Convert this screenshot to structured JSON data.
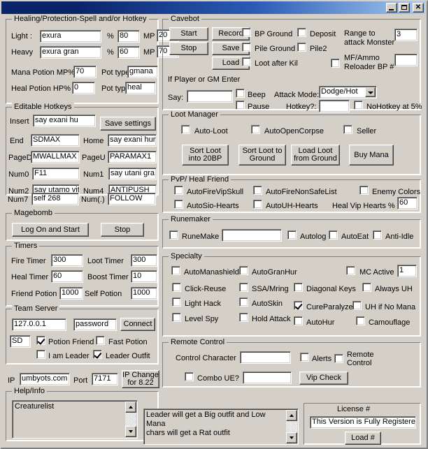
{
  "window": {
    "title": "",
    "minimize_label": "–",
    "maximize_label": "□",
    "close_label": "✕"
  },
  "healing": {
    "group_title": "Healing/Protection-Spell and/or Hotkey",
    "light_label": "Light :",
    "light_spell": "exura",
    "light_pct_sym": "%",
    "light_pct": "80",
    "light_mp_label": "MP",
    "light_mp": "20",
    "heavy_label": "Heavy",
    "heavy_spell": "exura gran",
    "heavy_pct_sym": "%",
    "heavy_pct": "60",
    "heavy_mp_label": "MP",
    "heavy_mp": "70",
    "mana_pot_label": "Mana Potion MP%",
    "mana_pot_value": "70",
    "mana_pot_type_label": "Pot type",
    "mana_pot_type": "gmana",
    "heal_pot_label": "Heal Potion HP%",
    "heal_pot_value": "0",
    "heal_pot_type_label": "Pot type",
    "heal_pot_type": "heal"
  },
  "hotkeys": {
    "group_title": "Editable Hotkeys",
    "save_button": "Save settings",
    "rows": [
      {
        "label": "Insert",
        "value": "say exani hu"
      },
      {
        "label": "End",
        "value": "SDMAX"
      },
      {
        "label": "Home",
        "value": "say exani hur"
      },
      {
        "label": "PageD",
        "value": "MWALLMAX"
      },
      {
        "label": "PageU",
        "value": "PARAMAX1"
      },
      {
        "label": "Num0",
        "value": "F11"
      },
      {
        "label": "Num1",
        "value": "say utani gra"
      },
      {
        "label": "Num2",
        "value": "say utamo vit"
      },
      {
        "label": "Num4",
        "value": "ANTIPUSH"
      },
      {
        "label": "Num7",
        "value": "self 268"
      },
      {
        "label": "Num(.)",
        "value": "FOLLOW"
      }
    ]
  },
  "magebomb": {
    "group_title": "Magebomb",
    "start_button": "Log On and Start",
    "stop_button": "Stop"
  },
  "timers": {
    "group_title": "Timers",
    "fire_label": "Fire Timer",
    "fire_value": "300",
    "loot_label": "Loot Timer",
    "loot_value": "300",
    "heal_label": "Heal Timer",
    "heal_value": "60",
    "boost_label": "Boost Timer",
    "boost_value": "10",
    "friend_pot_label": "Friend Potion",
    "friend_pot_value": "1000",
    "self_pot_label": "Self Potion",
    "self_pot_value": "1000"
  },
  "team_server": {
    "group_title": "Team Server",
    "ip_value": "127.0.0.1",
    "password_value": "password",
    "connect_button": "Connect",
    "sd_value": "SD",
    "potion_friend_label": "Potion Friend",
    "potion_friend_checked": true,
    "fast_potion_label": "Fast Potion",
    "fast_potion_checked": false,
    "i_am_leader_label": "I am Leader",
    "i_am_leader_checked": false,
    "leader_outfit_label": "Leader Outfit",
    "leader_outfit_checked": true
  },
  "ip_bar": {
    "ip_label": "IP",
    "ip_value": "umbyots.com",
    "port_label": "Port",
    "port_value": "7171",
    "ip_change_button": "IP Change\nfor 8.22"
  },
  "help_info": {
    "group_title": "Help/Info",
    "left_text": "Creaturelist",
    "right_text": "Leader will get a Big outfit and Low Mana\nchars will get a Rat outfit"
  },
  "license": {
    "title": "License #",
    "status": "This Version is Fully Registered!",
    "load_button": "Load #"
  },
  "cavebot": {
    "group_title": "Cavebot",
    "start_button": "Start",
    "record_button": "Record",
    "stop_button": "Stop",
    "save_button": "Save",
    "load_button": "Load",
    "bp_ground_label": "BP Ground",
    "bp_ground_checked": false,
    "deposit_label": "Deposit",
    "deposit_checked": false,
    "pile_ground_label": "Pile Ground",
    "pile_ground_checked": false,
    "pile2_label": "Pile2",
    "pile2_checked": false,
    "loot_after_kill_label": "Loot after Kil",
    "loot_after_kill_checked": false,
    "range_label": "Range to\nattack Monster",
    "range_value": "3",
    "mf_ammo_label": "MF/Ammo\nReloader BP #",
    "mf_ammo_checked": false,
    "mf_ammo_value": "",
    "player_gm_label": "If Player or GM Enter",
    "say_label": "Say:",
    "say_value": "",
    "beep_label": "Beep",
    "beep_checked": false,
    "pause_label": "Pause",
    "pause_checked": false,
    "attack_mode_label": "Attack Mode:",
    "attack_mode_value": "Dodge/Hot",
    "attack_mode_options": [
      "Dodge/Hot"
    ],
    "hotkey_label": "Hotkey?:",
    "hotkey_value": "",
    "nohotkey_label": "NoHotkey at 5%",
    "nohotkey_checked": false
  },
  "loot_manager": {
    "group_title": "Loot Manager",
    "auto_loot_label": "Auto-Loot",
    "auto_loot_checked": false,
    "auto_open_corpse_label": "AutoOpenCorpse",
    "auto_open_corpse_checked": false,
    "seller_label": "Seller",
    "seller_checked": false,
    "sort_20bp_button": "Sort Loot\ninto 20BP",
    "sort_ground_button": "Sort Loot to\nGround",
    "load_ground_button": "Load Loot\nfrom Ground",
    "buy_mana_button": "Buy Mana"
  },
  "pvp": {
    "group_title": "PvP/ Heal Friend",
    "autofire_vip_skull_label": "AutoFireVipSkull",
    "autofire_vip_skull_checked": false,
    "autofire_nonsafe_label": "AutoFireNonSafeList",
    "autofire_nonsafe_checked": false,
    "enemy_colors_label": "Enemy Colors",
    "enemy_colors_checked": false,
    "autosio_hearts_label": "AutoSio-Hearts",
    "autosio_hearts_checked": false,
    "autouh_hearts_label": "AutoUH-Hearts",
    "autouh_hearts_checked": false,
    "heal_vip_label": "Heal Vip Hearts %",
    "heal_vip_value": "60"
  },
  "runemaker": {
    "group_title": "Runemaker",
    "runemake_label": "RuneMake",
    "runemake_checked": false,
    "runemake_value": "",
    "autolog_label": "Autolog",
    "autolog_checked": false,
    "autoeat_label": "AutoEat",
    "autoeat_checked": false,
    "antiidle_label": "Anti-Idle",
    "antiidle_checked": false
  },
  "specialty": {
    "group_title": "Specialty",
    "items": [
      {
        "label": "AutoManashield",
        "checked": false
      },
      {
        "label": "AutoGranHur",
        "checked": false
      },
      {
        "label": "MC Active",
        "checked": false
      },
      {
        "label": "Click-Reuse",
        "checked": false
      },
      {
        "label": "SSA/Mring",
        "checked": false
      },
      {
        "label": "Diagonal Keys",
        "checked": false
      },
      {
        "label": "Always UH",
        "checked": false
      },
      {
        "label": "Light Hack",
        "checked": false
      },
      {
        "label": "AutoSkin",
        "checked": false
      },
      {
        "label": "CureParalyze",
        "checked": true
      },
      {
        "label": "UH if No Mana",
        "checked": false
      },
      {
        "label": "Level Spy",
        "checked": false
      },
      {
        "label": "Hold Attack",
        "checked": false
      },
      {
        "label": "AutoHur",
        "checked": false
      },
      {
        "label": "Camouflage",
        "checked": false
      }
    ],
    "mc_active_value": "1"
  },
  "remote": {
    "group_title": "Remote Control",
    "control_char_label": "Control Character",
    "control_char_value": "",
    "alerts_label": "Alerts",
    "alerts_checked": false,
    "remote_control_label": "Remote\nControl",
    "remote_control_checked": false,
    "combo_ue_label": "Combo UE?",
    "combo_ue_checked": false,
    "combo_ue_value": "",
    "vip_check_button": "Vip Check"
  }
}
